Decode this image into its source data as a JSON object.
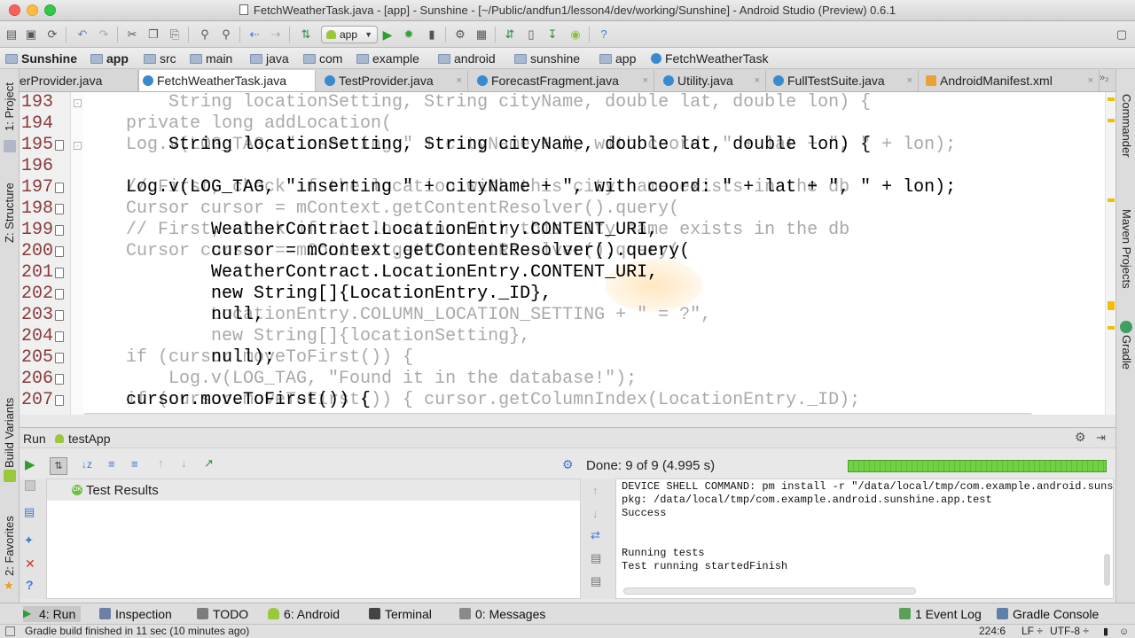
{
  "window": {
    "title": "FetchWeatherTask.java - [app] - Sunshine - [~/Public/andfun1/lesson4/dev/working/Sunshine] - Android Studio (Preview) 0.6.1"
  },
  "toolbar": {
    "run_config": "app"
  },
  "breadcrumbs": [
    "Sunshine",
    "app",
    "src",
    "main",
    "java",
    "com",
    "example",
    "android",
    "sunshine",
    "app",
    "FetchWeatherTask"
  ],
  "tabs": [
    "erProvider.java",
    "FetchWeatherTask.java",
    "TestProvider.java",
    "ForecastFragment.java",
    "Utility.java",
    "FullTestSuite.java",
    "AndroidManifest.xml"
  ],
  "tab_overflow": "»₂",
  "left_tools": {
    "project": "1: Project",
    "structure": "Z: Structure",
    "build_variants": "Build Variants",
    "favorites": "2: Favorites"
  },
  "right_tools": {
    "commander": "Commander",
    "maven": "Maven Projects",
    "gradle": "Gradle"
  },
  "editor": {
    "line_numbers": [
      "193",
      "194",
      "195",
      "196",
      "197",
      "198",
      "199",
      "200",
      "201",
      "202",
      "203",
      "204",
      "205",
      "206",
      "207"
    ],
    "ghost_lines": [
      "        String locationSetting, String cityName, double lat, double lon) {",
      "    private long addLocation(",
      "    Log.v(LOG_TAG, \"inserting \" + cityName + \", with coord: \" + lat + \", \" + lon);",
      "",
      "    // First, check if the location with this city name exists in the db",
      "    Cursor cursor = mContext.getContentResolver().query(",
      "    // First, check if the location with this city name exists in the db",
      "    Cursor cursor = mContext.getContentResolver().query(",
      "            WeatherContract.LocationEntry.CONTENT_URI,",
      "            new String[]{LocationEntry._ID},",
      "            LocationEntry.COLUMN_LOCATION_SETTING + \" = ?\",",
      "            new String[]{locationSetting},",
      "    if (cursor.moveToFirst()) {",
      "        Log.v(LOG_TAG, \"Found it in the database!\");",
      "    if (cursor.moveToFirst()) { cursor.getColumnIndex(LocationEntry._ID);"
    ],
    "front_lines": [
      "",
      "",
      "        String locationSetting, String cityName, double lat, double lon) {",
      "",
      "    Log.v(LOG_TAG, \"inserting \" + cityName + \", with coord: \" + lat + \", \" + lon);",
      "",
      "            WeatherContract.LocationEntry.CONTENT_URI,",
      "            cursor = mContext.getContentResolver().query(",
      "            WeatherContract.LocationEntry.CONTENT_URI,",
      "            new String[]{LocationEntry._ID},",
      "            null,",
      "",
      "            null);",
      "",
      "    cursor.moveToFirst()) {"
    ]
  },
  "run_panel": {
    "title": "Run",
    "config": "testApp",
    "done_text": "Done: 9 of 9  (4.995 s)",
    "progress": 1.0,
    "tree_root": "Test Results",
    "console": [
      "DEVICE SHELL COMMAND: pm install -r \"/data/local/tmp/com.example.android.suns",
      "pkg: /data/local/tmp/com.example.android.sunshine.app.test",
      "Success",
      "",
      "",
      "Running tests",
      "Test running startedFinish"
    ]
  },
  "tool_windows": {
    "run": "4: Run",
    "inspection": "Inspection",
    "todo": "TODO",
    "android": "6: Android",
    "terminal": "Terminal",
    "messages": "0: Messages",
    "event_log": "1 Event Log",
    "gradle_console": "Gradle Console"
  },
  "status": {
    "message": "Gradle build finished in 11 sec (10 minutes ago)",
    "position": "224:6",
    "line_sep": "LF ÷",
    "encoding": "UTF-8 ÷"
  },
  "colors": {
    "keyword": "#000080",
    "string": "#008000",
    "field": "#660e7a",
    "line_number": "#8a3a3a",
    "progress": "#6fd143"
  }
}
